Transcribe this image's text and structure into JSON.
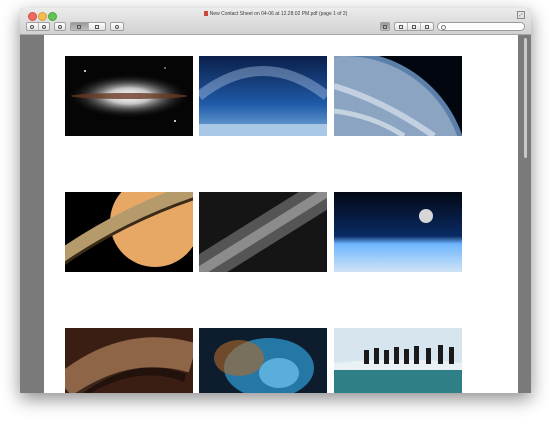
{
  "window": {
    "title": "New Contact Sheet on 04-06 at 12.28.02 PM.pdf (page 1 of 2)"
  },
  "toolbar": {
    "buttons": [
      "zoom-out-icon",
      "zoom-in-icon",
      "rotate-icon",
      "single-page-icon",
      "two-page-icon",
      "edit-icon"
    ],
    "view_buttons": [
      "thumbnails-icon",
      "sidebar-icon",
      "previous-page-icon",
      "next-page-icon"
    ],
    "search_placeholder": ""
  },
  "contact_sheet": {
    "thumbnails": [
      {
        "name": "sombrero-galaxy"
      },
      {
        "name": "milky-way-blue-sky"
      },
      {
        "name": "earth-clouds-from-orbit"
      },
      {
        "name": "saturn-rings"
      },
      {
        "name": "milky-way-band"
      },
      {
        "name": "earth-horizon-moon"
      },
      {
        "name": "galactic-dust-lanes"
      },
      {
        "name": "blue-nebula"
      },
      {
        "name": "penguins-on-ice"
      }
    ]
  }
}
